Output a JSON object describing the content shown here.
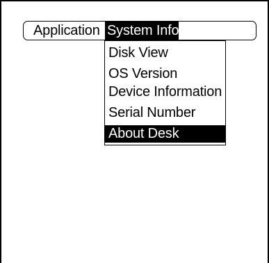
{
  "menubar": {
    "items": [
      {
        "label": "Application",
        "selected": false
      },
      {
        "label": "System Info",
        "selected": true
      }
    ]
  },
  "dropdown": {
    "items": [
      {
        "label": "Disk View",
        "highlighted": false
      },
      {
        "label": "OS Version",
        "highlighted": false
      },
      {
        "label": "Device Information",
        "highlighted": false
      },
      {
        "label": "Serial Number",
        "highlighted": false
      },
      {
        "label": "About Desk",
        "highlighted": true
      }
    ]
  },
  "colors": {
    "background": "#ffffff",
    "foreground": "#000000",
    "highlight": "#000000",
    "highlight_text": "#ffffff"
  }
}
